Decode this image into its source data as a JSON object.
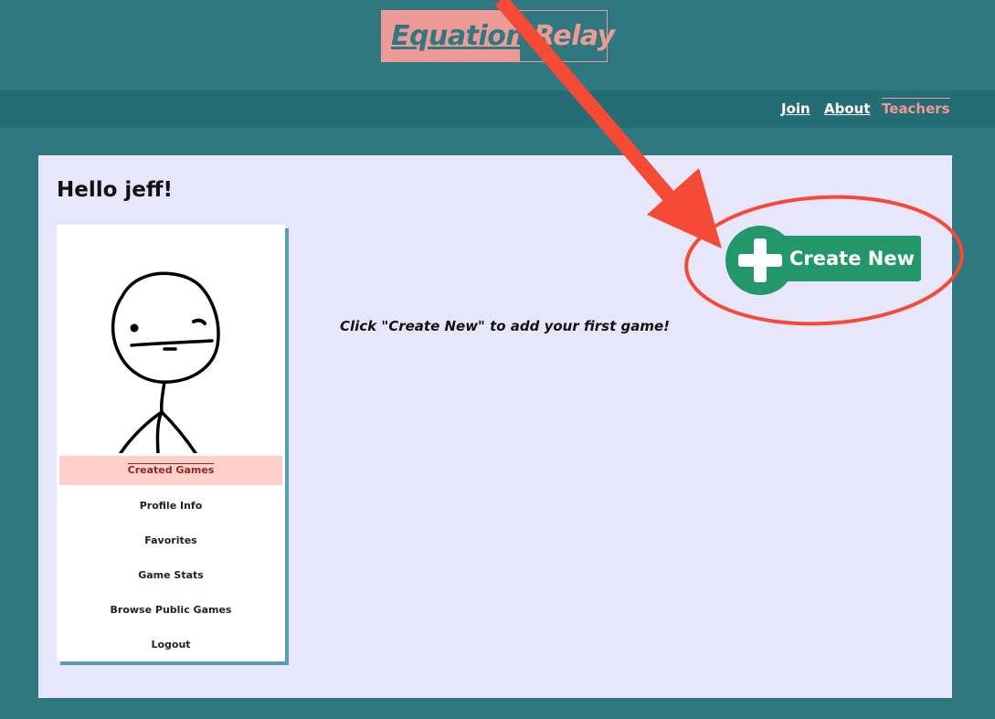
{
  "header": {
    "logo_word1": "Equation",
    "logo_word2": "Relay",
    "nav": [
      {
        "label": "Join"
      },
      {
        "label": "About"
      },
      {
        "label": "Teachers"
      }
    ]
  },
  "main": {
    "greeting": "Hello jeff!",
    "empty_message": "Click \"Create New\" to add your first game!",
    "create_button_label": "Create New"
  },
  "sidebar": {
    "menu": [
      {
        "label": "Created Games"
      },
      {
        "label": "Profile Info"
      },
      {
        "label": "Favorites"
      },
      {
        "label": "Game Stats"
      },
      {
        "label": "Browse Public Games"
      },
      {
        "label": "Logout"
      }
    ]
  },
  "colors": {
    "background": "#2f7880",
    "navbar": "#266c75",
    "accent_pink": "#ee9a97",
    "card": "#e7e6fb",
    "create_green": "#23976a",
    "annotation_red": "#f44a36"
  },
  "icons": [
    "plus-icon",
    "avatar-drawing"
  ]
}
